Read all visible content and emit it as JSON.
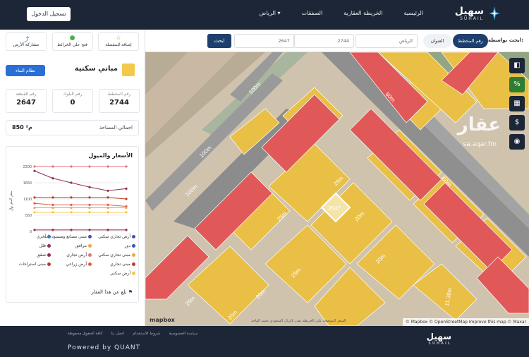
{
  "nav": {
    "logo_ar": "سهيل",
    "logo_en": "SUHAIL",
    "links": [
      "الرئيسية",
      "الخريطة العقارية",
      "الصفقات",
      "الرياض ▾"
    ],
    "login": "تسجيل الدخول"
  },
  "panel": {
    "actions": [
      {
        "label": "إضافة للمفضلة",
        "icon": "star-icon"
      },
      {
        "label": "فتح على الخرائط",
        "icon": "map-pin-icon"
      },
      {
        "label": "مشاركة الأرض",
        "icon": "share-icon"
      }
    ],
    "title": "مباني سكنية",
    "build_btn": "نظام البناء",
    "stats": [
      {
        "label": "رقم المخطط",
        "value": "2744"
      },
      {
        "label": "رقم البلوك",
        "value": "0"
      },
      {
        "label": "رقم القطعة",
        "value": "2647"
      }
    ],
    "area_label": "اجمالي المساحة",
    "area_value": "850 م²",
    "chart_title": "الأسعار والميول",
    "report": "بلغ عن هذا العقار"
  },
  "legend": [
    {
      "label": "أرض تجاري سكني",
      "color": "#3f51b5"
    },
    {
      "label": "مبنى مصانع ومستودعات",
      "color": "#3f51b5"
    },
    {
      "label": "أخرى",
      "color": "#2e7bd6"
    },
    {
      "label": "دور",
      "color": "#3f51b5"
    },
    {
      "label": "مرافق",
      "color": "#f2a63a"
    },
    {
      "label": "فلل",
      "color": "#8e2d5a"
    },
    {
      "label": "مبنى تجاري سكني",
      "color": "#f2a63a"
    },
    {
      "label": "أرض تجاري",
      "color": "#e57373"
    },
    {
      "label": "شقق",
      "color": "#8e2d5a"
    },
    {
      "label": "مبنى تجاري",
      "color": "#c0392b"
    },
    {
      "label": "أرض زراعي",
      "color": "#e06040"
    },
    {
      "label": "مبنى استراحات",
      "color": "#b23b3b"
    },
    {
      "label": "أرض سكني",
      "color": "#f4c94a"
    }
  ],
  "search": {
    "label": "ابحث بواسطة:",
    "opt_plan": "رقم المخطط",
    "opt_address": "العنوان",
    "city": "الرياض",
    "plan_value": "2744",
    "parcel_value": "2647",
    "button": "ابحث"
  },
  "map": {
    "selected": "2647",
    "watermark": "عقار",
    "watermark_sub": "sa.aqar.fm",
    "mapbox": "mapbox",
    "attribution": "© Mapbox © OpenStreetMap Improve this map © Maxar",
    "disclaimer": "السعر الموضحة على الخريطة تقدر بالريال السعودي تعتمد الواحد",
    "roads": [
      "100m",
      "100m",
      "100m",
      "60m",
      "60m",
      "25m",
      "25m",
      "20m",
      "20m",
      "25m",
      "25m",
      "20m",
      "20m",
      "11.38m"
    ]
  },
  "chart_data": {
    "type": "line",
    "title": "الأسعار والميول",
    "ylabel": "سعر المتر ﷼",
    "yticks": [
      0,
      550,
      1100,
      1650,
      2200
    ],
    "ylim": [
      0,
      2200
    ],
    "x": [
      "",
      "",
      "",
      "",
      "",
      ""
    ],
    "series": [
      {
        "values": [
          2200,
          2200,
          2200,
          2200,
          2200,
          2200
        ],
        "color": "#e57373"
      },
      {
        "values": [
          2050,
          1800,
          1650,
          1500,
          1380,
          1450
        ],
        "color": "#8e2d5a"
      },
      {
        "values": [
          1150,
          1150,
          1150,
          1150,
          1150,
          1100
        ],
        "color": "#c0392b"
      },
      {
        "values": [
          950,
          900,
          900,
          900,
          900,
          850
        ],
        "color": "#e06040"
      },
      {
        "values": [
          800,
          800,
          800,
          800,
          800,
          800
        ],
        "color": "#f2a63a"
      },
      {
        "values": [
          650,
          650,
          650,
          650,
          650,
          650
        ],
        "color": "#f4c94a"
      },
      {
        "values": [
          50,
          50,
          50,
          50,
          50,
          50
        ],
        "color": "#8e2d5a"
      }
    ]
  },
  "footer": {
    "links": [
      "سياسة الخصوصية",
      "شروط الاستخدام",
      "اتصل بنا",
      "كافة الحقوق محفوظة"
    ],
    "powered": "Powered by QUANT",
    "logo_ar": "سهيل",
    "logo_en": "SUHAIL"
  }
}
